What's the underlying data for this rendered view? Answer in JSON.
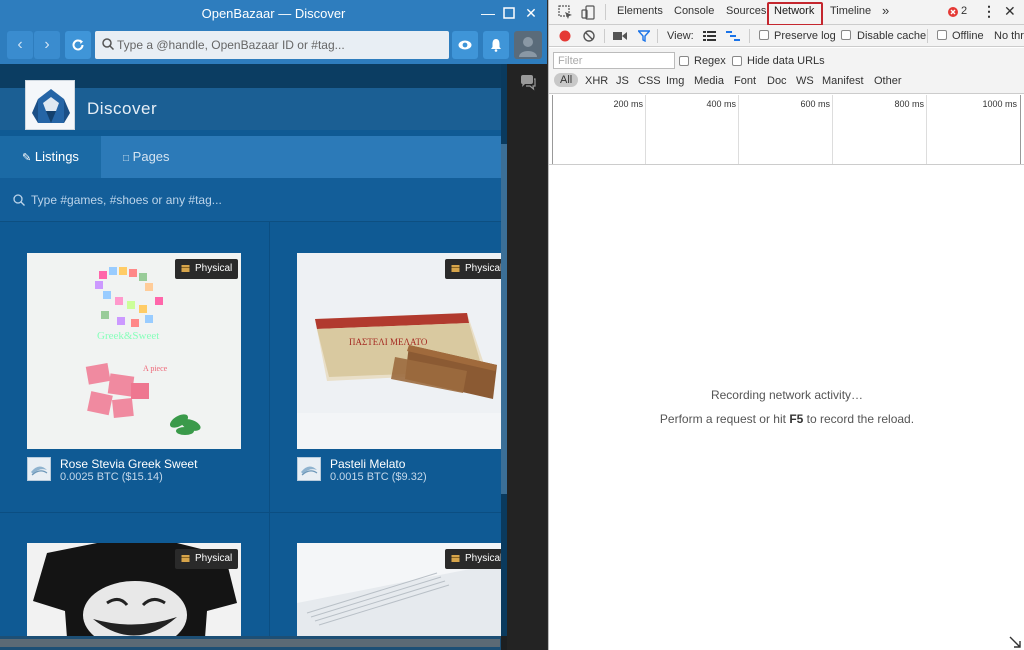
{
  "window": {
    "title": "OpenBazaar — Discover"
  },
  "navbar": {
    "search_placeholder": "Type a @handle, OpenBazaar ID or #tag..."
  },
  "discover": {
    "title": "Discover",
    "tabs": [
      {
        "label": "Listings"
      },
      {
        "label": "Pages"
      }
    ],
    "search_placeholder": "Type #games, #shoes or any #tag..."
  },
  "listings": [
    {
      "badge": "Physical",
      "title": "Rose Stevia Greek Sweet",
      "price": "0.0025 BTC ($15.14)"
    },
    {
      "badge": "Physical",
      "title": "Pasteli Melato",
      "price": "0.0015 BTC ($9.32)"
    },
    {
      "badge": "Physical"
    },
    {
      "badge": "Physical"
    }
  ],
  "devtools": {
    "tabs": [
      "Elements",
      "Console",
      "Sources",
      "Network",
      "Timeline"
    ],
    "more": "»",
    "error_count": "2",
    "toolbar": {
      "view_label": "View:",
      "preserve_log": "Preserve log",
      "disable_cache": "Disable cache",
      "offline": "Offline",
      "throttle": "No thr"
    },
    "filter": {
      "placeholder": "Filter",
      "regex": "Regex",
      "hide_data_urls": "Hide data URLs",
      "types": [
        "All",
        "XHR",
        "JS",
        "CSS",
        "Img",
        "Media",
        "Font",
        "Doc",
        "WS",
        "Manifest",
        "Other"
      ]
    },
    "timeline_ticks": [
      "200 ms",
      "400 ms",
      "600 ms",
      "800 ms",
      "1000 ms"
    ],
    "empty": {
      "line1": "Recording network activity…",
      "line2_prefix": "Perform a request or hit ",
      "line2_key": "F5",
      "line2_suffix": " to record the reload."
    },
    "colors": {
      "record": "#e53935",
      "highlight": "#c4262e"
    }
  },
  "colors": {
    "ob_blue": "#2e7dbe",
    "page_blue": "#0f5a94"
  }
}
